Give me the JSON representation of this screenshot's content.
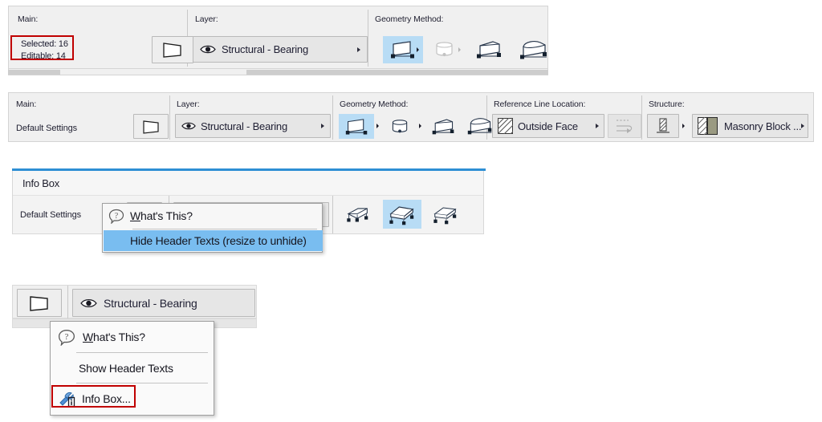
{
  "panel1": {
    "section_labels": {
      "main": "Main:",
      "layer": "Layer:",
      "geometry": "Geometry Method:"
    },
    "status": {
      "selected": "Selected: 16",
      "editable": "Editable: 14"
    },
    "tool_icon": "wall-tool-icon",
    "layer_value": "Structural - Bearing",
    "layer_icon": "eye-icon",
    "geometry_icons": [
      "straight-wall-icon",
      "curved-wall-icon",
      "trapezoid-wall-icon",
      "polygon-wall-icon"
    ],
    "selected_geometry_index": 0,
    "highlight_color": "#c00000"
  },
  "panel2": {
    "section_labels": {
      "main": "Main:",
      "layer": "Layer:",
      "geometry": "Geometry Method:",
      "refline": "Reference Line Location:",
      "structure": "Structure:"
    },
    "main_value": "Default Settings",
    "tool_icon": "wall-tool-icon",
    "layer_value": "Structural - Bearing",
    "layer_icon": "eye-icon",
    "geometry_icons": [
      "straight-wall-icon",
      "curved-wall-icon",
      "trapezoid-wall-icon",
      "polygon-wall-icon"
    ],
    "selected_geometry_index": 0,
    "refline_value": "Outside Face",
    "refline_icon": "hatch-swatch-icon",
    "flip_icon": "flip-wall-icon",
    "structure_icon": "composite-structure-icon",
    "structure_value": "Masonry Block ...",
    "structure_swatch_icon": "masonry-swatch-icon"
  },
  "panel3": {
    "title": "Info Box",
    "main_value": "Default Settings",
    "geometry_icons": [
      "slab-edge-icon",
      "slab-solid-icon",
      "slab-plain-icon"
    ],
    "selected_geometry_index": 1,
    "menu": {
      "items": [
        {
          "label": "What's This?",
          "icon": "question-balloon-icon",
          "highlighted": false,
          "underline": "W"
        },
        {
          "label": "Hide Header Texts (resize to unhide)",
          "icon": "",
          "highlighted": true,
          "underline": ""
        }
      ]
    }
  },
  "panel4": {
    "tool_icon": "wall-tool-icon",
    "layer_value": "Structural - Bearing",
    "layer_icon": "eye-icon",
    "menu": {
      "items": [
        {
          "label": "What's This?",
          "icon": "question-balloon-icon",
          "highlighted": false,
          "boxed": false
        },
        {
          "label": "Show Header Texts",
          "icon": "",
          "highlighted": false,
          "boxed": false
        },
        {
          "label": "Info Box...",
          "icon": "info-box-tool-icon",
          "highlighted": false,
          "boxed": true
        }
      ]
    },
    "highlight_color": "#c00000"
  }
}
